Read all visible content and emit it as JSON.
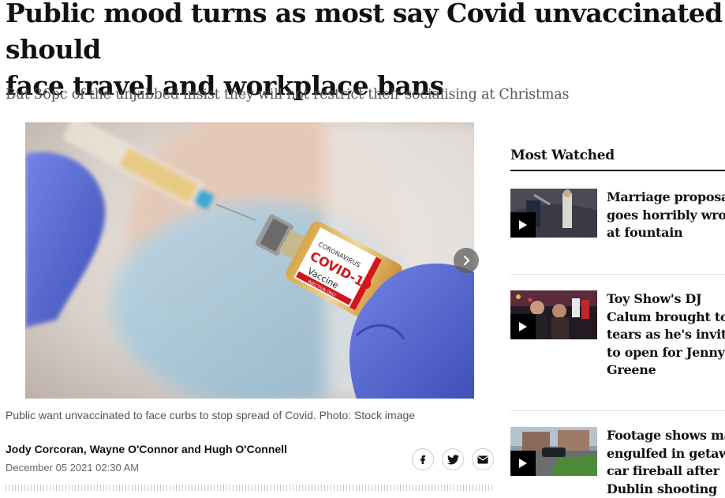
{
  "article": {
    "headline_line1": "Public mood turns as most say Covid unvaccinated should",
    "headline_line2": "face travel and workplace bans",
    "subhead": "But 36pc of the unjabbed insist they will not restrict their socialising at Christmas",
    "image": {
      "vial_brand": "CORONAVIRUS",
      "vial_title": "COVID-19",
      "vial_sub": "Vaccine",
      "vial_tag": "INJECTION ONLY"
    },
    "caption": "Public want unvaccinated to face curbs to stop spread of Covid. Photo: Stock image",
    "byline": "Jody Corcoran, Wayne O'Connor and Hugh O'Connell",
    "date": "December 05 2021 02:30 AM"
  },
  "most_watched": {
    "title": "Most Watched",
    "items": [
      {
        "line1": "Marriage proposal",
        "line2": "goes horribly wrong",
        "line3": "at fountain"
      },
      {
        "line1": "Toy Show's DJ",
        "line2": "Calum brought to",
        "line3": "tears as he's invited",
        "line4": "to open for Jenny",
        "line5": "Greene"
      },
      {
        "line1": "Footage shows man",
        "line2": "engulfed in getaway",
        "line3": "car fireball after",
        "line4": "Dublin shooting"
      }
    ]
  },
  "colors": {
    "glove": "#5b6fd6",
    "vial_red": "#d4151b",
    "text": "#111111"
  },
  "icons": [
    "chevron-right-icon",
    "facebook-icon",
    "twitter-icon",
    "email-icon",
    "play-icon"
  ]
}
